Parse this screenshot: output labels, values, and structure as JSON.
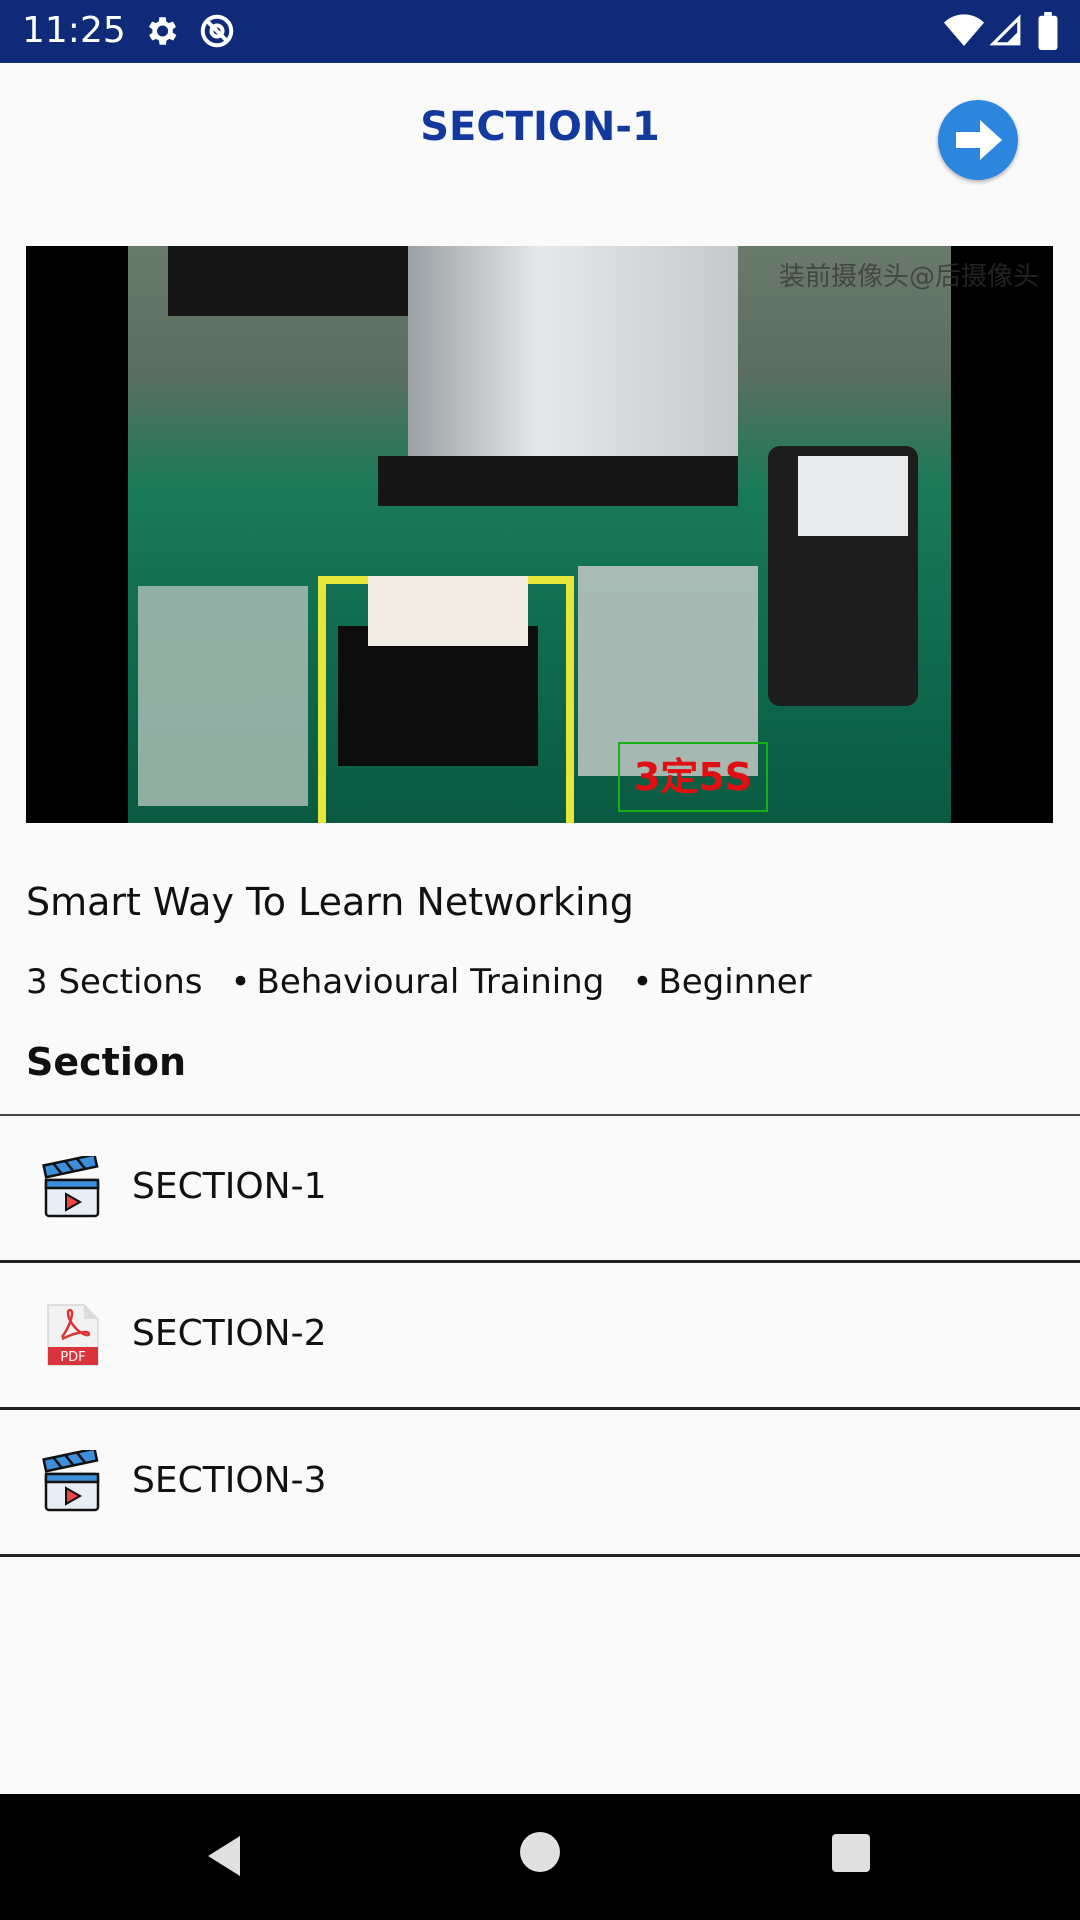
{
  "status_bar": {
    "time": "11:25",
    "icons": [
      "gear-icon",
      "at-icon",
      "wifi-icon",
      "signal-icon",
      "battery-icon"
    ],
    "background": "#0f2a78"
  },
  "header": {
    "title": "SECTION-1",
    "title_color": "#13389e",
    "next_icon": "arrow-right-circle-icon",
    "next_color": "#2d86de"
  },
  "video": {
    "watermark": "装前摄像头@后摄像头",
    "caption": "3定5S"
  },
  "course": {
    "title": "Smart Way To Learn Networking",
    "sections_count": "3 Sections",
    "category": "Behavioural Training",
    "level": "Beginner",
    "separator": "•"
  },
  "section_heading": "Section",
  "sections": [
    {
      "label": "SECTION-1",
      "icon": "video-clapper-icon"
    },
    {
      "label": "SECTION-2",
      "icon": "pdf-icon"
    },
    {
      "label": "SECTION-3",
      "icon": "video-clapper-icon"
    }
  ],
  "nav_bar": {
    "icons": [
      "back-icon",
      "home-icon",
      "recents-icon"
    ]
  }
}
